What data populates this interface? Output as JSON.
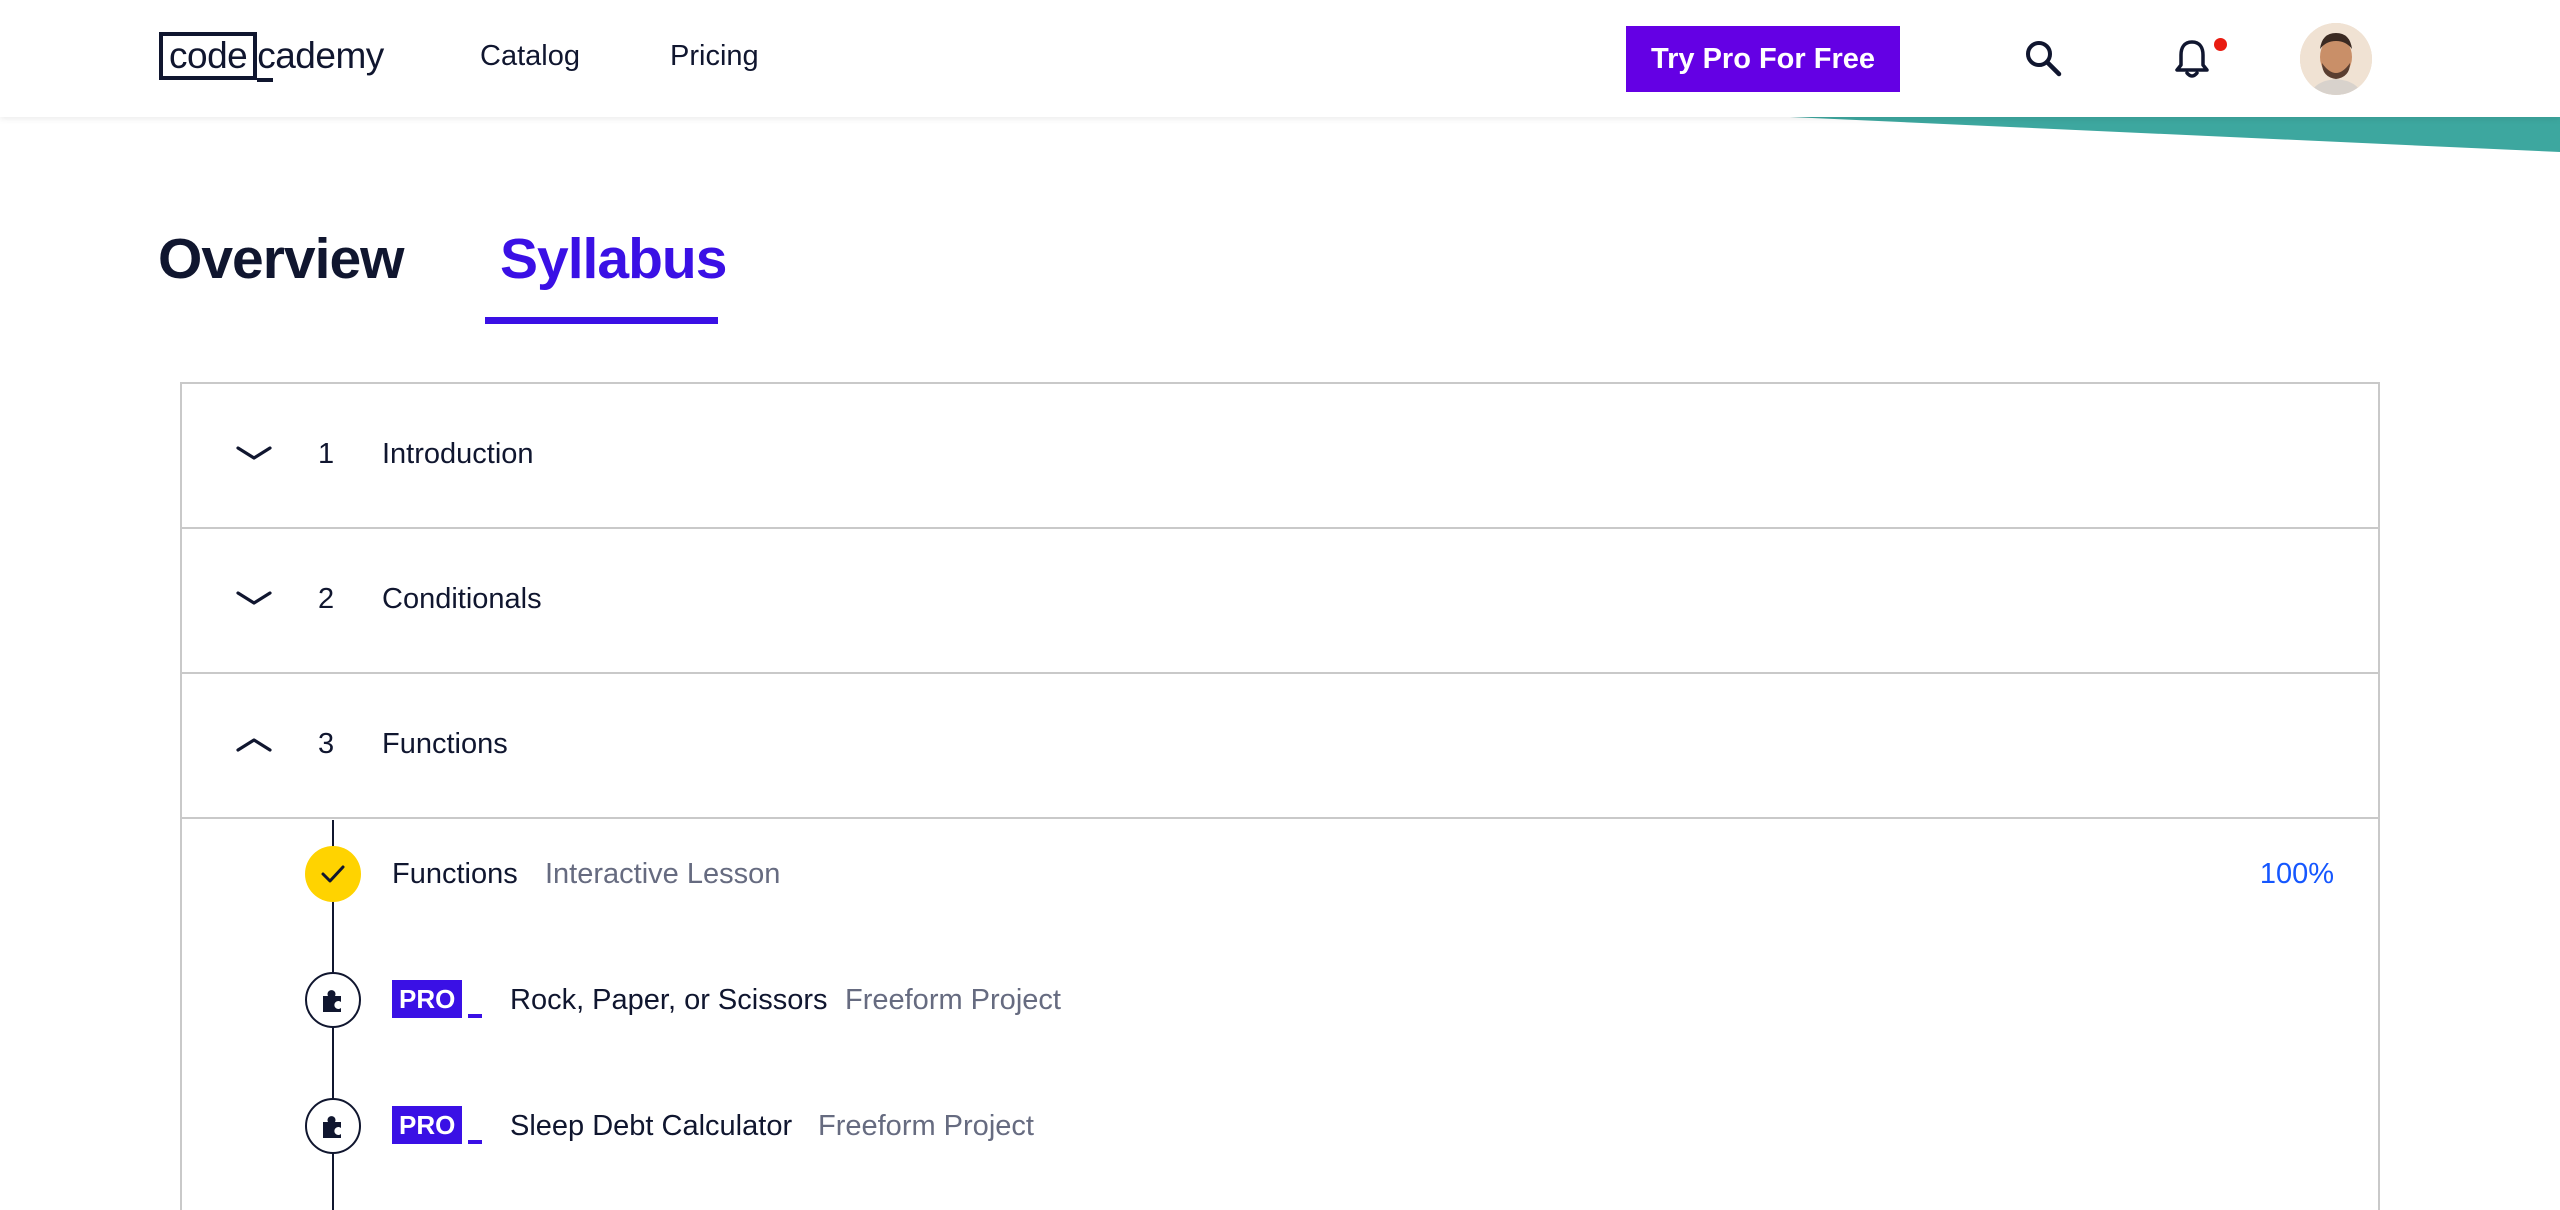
{
  "header": {
    "logo_code": "code",
    "logo_cademy": "cademy",
    "nav": [
      "Catalog",
      "Pricing"
    ],
    "cta_label": "Try Pro For Free",
    "icons": [
      "search-icon",
      "bell-icon"
    ],
    "colors": {
      "cta": "#6400e4",
      "accent": "#3a10e5",
      "teal": "#3da79f",
      "notification_dot": "#e91c11"
    }
  },
  "tabs": [
    {
      "label": "Overview",
      "active": false
    },
    {
      "label": "Syllabus",
      "active": true
    }
  ],
  "syllabus": {
    "modules": [
      {
        "number": "1",
        "title": "Introduction",
        "expanded": false
      },
      {
        "number": "2",
        "title": "Conditionals",
        "expanded": false
      },
      {
        "number": "3",
        "title": "Functions",
        "expanded": true
      }
    ],
    "items": [
      {
        "name": "Functions",
        "type": "Interactive Lesson",
        "progress": "100%",
        "status": "complete",
        "icon": "check-icon"
      },
      {
        "pro": "PRO",
        "name": "Rock, Paper, or Scissors",
        "type": "Freeform Project",
        "icon": "puzzle-icon"
      },
      {
        "pro": "PRO",
        "name": "Sleep Debt Calculator",
        "type": "Freeform Project",
        "icon": "puzzle-icon"
      }
    ]
  }
}
